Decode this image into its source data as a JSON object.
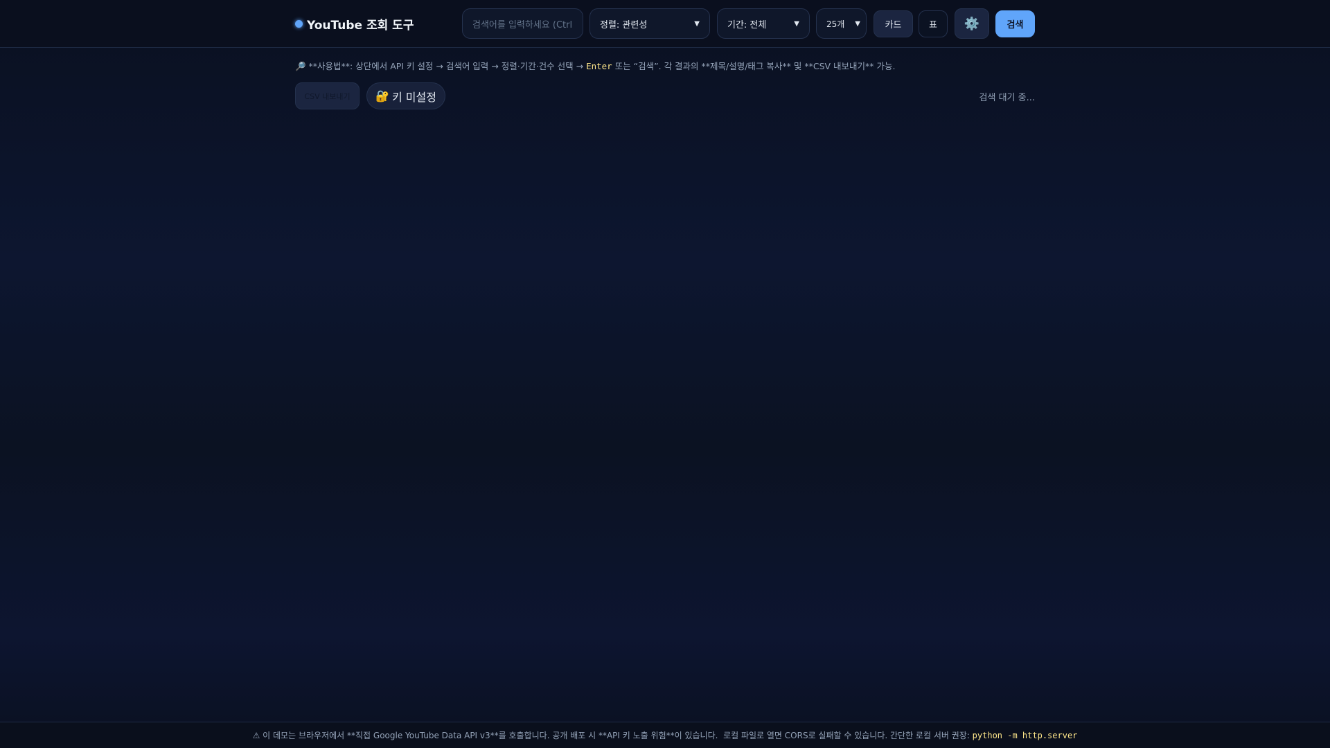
{
  "header": {
    "title": "YouTube 조회 도구",
    "search_placeholder": "검색어를 입력하세요 (Ctrl+K)",
    "sort": "정렬: 관련성",
    "period": "기간: 전체",
    "count": "25개",
    "view_card": "카드",
    "view_table": "표",
    "settings_icon": "⚙️",
    "search_button": "검색"
  },
  "info": {
    "prefix": "🔎 **사용법**: 상단에서 API 키 설정 → 검색어 입력 → 정렬·기간·건수 선택 → ",
    "key": "Enter",
    "suffix": " 또는 “검색”. 각 결과의 **제목/설명/태그 복사** 및 **CSV 내보내기** 가능."
  },
  "toolbar": {
    "csv": "CSV 내보내기",
    "key_icon": "🔐",
    "key_status": "키 미설정",
    "status": "검색 대기 중..."
  },
  "footer": {
    "text": "⚠ 이 데모는 브라우저에서 **직접 Google YouTube Data API v3**를 호출합니다. 공개 배포 시 **API 키 노출 위험**이 있습니다.  로컬 파일로 열면 CORS로 실패할 수 있습니다. 간단한 로컬 서버 권장: ",
    "command": "python -m http.server"
  },
  "colors": {
    "accent": "#60a5fa",
    "code": "#fde68a"
  }
}
